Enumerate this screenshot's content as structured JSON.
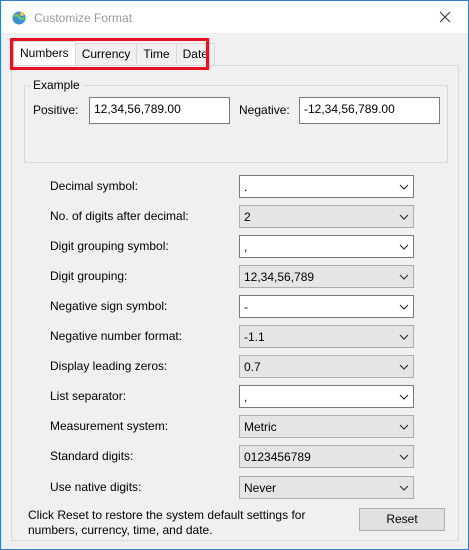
{
  "window": {
    "title": "Customize Format"
  },
  "tabs": [
    {
      "label": "Numbers"
    },
    {
      "label": "Currency"
    },
    {
      "label": "Time"
    },
    {
      "label": "Date"
    }
  ],
  "example": {
    "legend": "Example",
    "positive_label": "Positive:",
    "positive_value": "12,34,56,789.00",
    "negative_label": "Negative:",
    "negative_value": "-12,34,56,789.00"
  },
  "settings": [
    {
      "label": "Decimal symbol:",
      "value": "."
    },
    {
      "label": "No. of digits after decimal:",
      "value": "2"
    },
    {
      "label": "Digit grouping symbol:",
      "value": ","
    },
    {
      "label": "Digit grouping:",
      "value": "12,34,56,789"
    },
    {
      "label": "Negative sign symbol:",
      "value": "-"
    },
    {
      "label": "Negative number format:",
      "value": "-1.1"
    },
    {
      "label": "Display leading zeros:",
      "value": "0.7"
    },
    {
      "label": "List separator:",
      "value": ","
    },
    {
      "label": "Measurement system:",
      "value": "Metric"
    },
    {
      "label": "Standard digits:",
      "value": "0123456789"
    },
    {
      "label": "Use native digits:",
      "value": "Never"
    }
  ],
  "footer": {
    "text_line1": "Click Reset to restore the system default settings for",
    "text_line2": "numbers, currency, time, and date.",
    "reset_label": "Reset"
  },
  "colors": {
    "highlight": "#e81123",
    "window_border": "#2f7dd1"
  }
}
